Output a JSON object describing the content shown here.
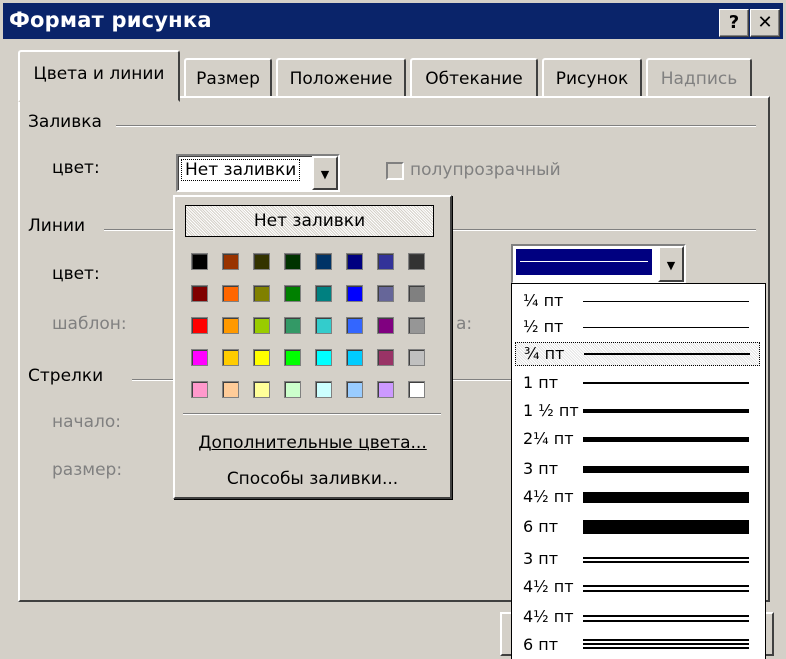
{
  "window": {
    "title": "Формат рисунка",
    "help_label": "?",
    "close_label": "✕"
  },
  "tabs": [
    {
      "label": "Цвета и линии",
      "active": true
    },
    {
      "label": "Размер"
    },
    {
      "label": "Положение"
    },
    {
      "label": "Обтекание"
    },
    {
      "label": "Рисунок"
    },
    {
      "label": "Надпись",
      "disabled": true
    }
  ],
  "fill": {
    "section_label": "Заливка",
    "color_label": "цвет:",
    "color_value": "Нет заливки",
    "translucent_label": "полупрозрачный"
  },
  "lines": {
    "section_label": "Линии",
    "color_label": "цвет:",
    "pattern_label": "шаблон:",
    "partial_label": "а:",
    "line_color": "#000080"
  },
  "arrows": {
    "section_label": "Стрелки",
    "begin_label": "начало:",
    "size_label": "размер:"
  },
  "color_popup": {
    "no_fill_label": "Нет заливки",
    "more_colors_label": "Дополнительные цвета...",
    "fill_effects_label": "Способы заливки...",
    "palette": [
      [
        "#000000",
        "#993300",
        "#333300",
        "#003300",
        "#003366",
        "#000080",
        "#333399",
        "#333333"
      ],
      [
        "#800000",
        "#ff6600",
        "#808000",
        "#008000",
        "#008080",
        "#0000ff",
        "#666699",
        "#808080"
      ],
      [
        "#ff0000",
        "#ff9900",
        "#99cc00",
        "#339966",
        "#33cccc",
        "#3366ff",
        "#800080",
        "#969696"
      ],
      [
        "#ff00ff",
        "#ffcc00",
        "#ffff00",
        "#00ff00",
        "#00ffff",
        "#00ccff",
        "#993366",
        "#c0c0c0"
      ],
      [
        "#ff99cc",
        "#ffcc99",
        "#ffff99",
        "#ccffcc",
        "#ccffff",
        "#99ccff",
        "#cc99ff",
        "#ffffff"
      ]
    ]
  },
  "line_styles": [
    {
      "label": "¼ пт",
      "weight": 0.25,
      "style": "single"
    },
    {
      "label": "½ пт",
      "weight": 0.5,
      "style": "single"
    },
    {
      "label": "¾ пт",
      "weight": 0.75,
      "style": "single",
      "selected": true
    },
    {
      "label": "1 пт",
      "weight": 1,
      "style": "single"
    },
    {
      "label": "1 ½ пт",
      "weight": 1.5,
      "style": "single"
    },
    {
      "label": "2¼ пт",
      "weight": 2.25,
      "style": "single"
    },
    {
      "label": "3 пт",
      "weight": 3,
      "style": "single"
    },
    {
      "label": "4½ пт",
      "weight": 4.5,
      "style": "single"
    },
    {
      "label": "6 пт",
      "weight": 6,
      "style": "single"
    },
    {
      "label": "3 пт",
      "weight": 3,
      "style": "double"
    },
    {
      "label": "4½ пт",
      "weight": 4.5,
      "style": "double"
    },
    {
      "label": "4½ пт",
      "weight": 4.5,
      "style": "double"
    },
    {
      "label": "6 пт",
      "weight": 6,
      "style": "triple"
    }
  ]
}
